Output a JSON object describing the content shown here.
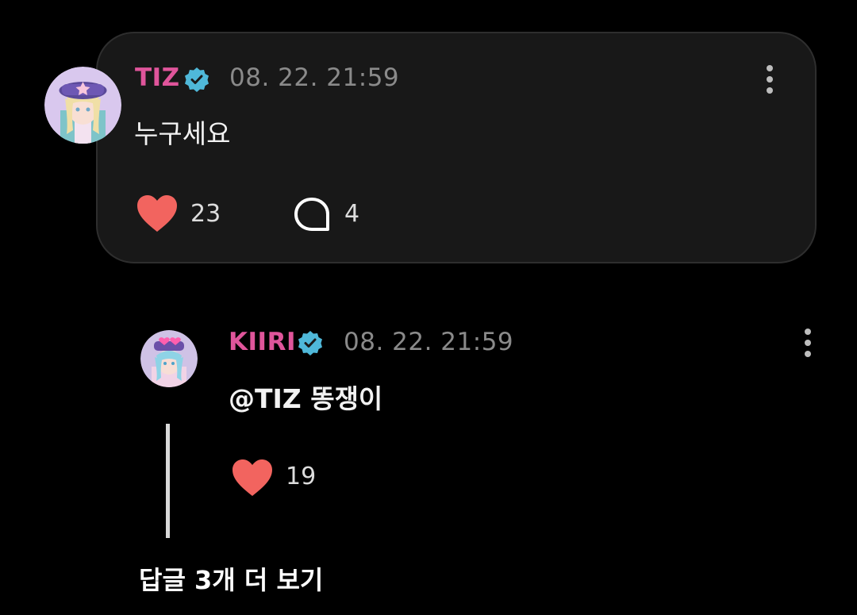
{
  "comment": {
    "author": "TIZ",
    "timestamp": "08. 22. 21:59",
    "text": "누구세요",
    "likes": "23",
    "replies": "4",
    "name_color": "#e0559b"
  },
  "reply": {
    "author": "KIIRI",
    "timestamp": "08. 22. 21:59",
    "text": "@TIZ 똥쟁이",
    "likes": "19"
  },
  "more_replies_label": "답글 3개 더 보기",
  "colors": {
    "heart": "#f2645f",
    "verified": "#4fb8d9",
    "card_bg": "#181818"
  },
  "icons": [
    "verified-badge-icon",
    "more-options-icon",
    "heart-icon",
    "comment-bubble-icon"
  ]
}
